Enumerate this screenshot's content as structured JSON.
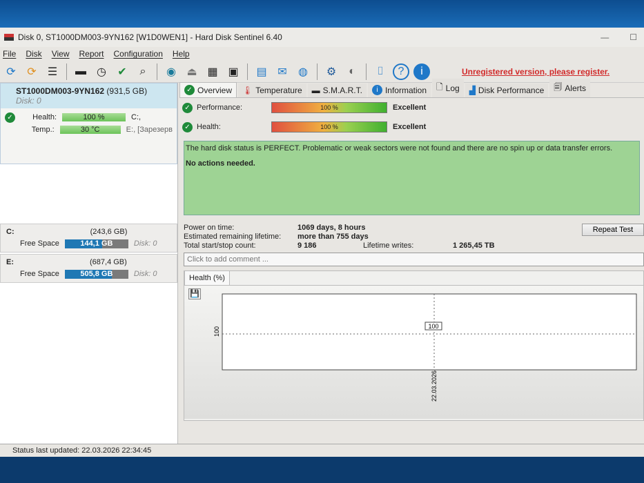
{
  "window": {
    "title": "Disk 0, ST1000DM003-9YN162 [W1D0WEN1]  -  Hard Disk Sentinel 6.40",
    "minimize": "—",
    "maximize": "☐"
  },
  "menu": [
    "File",
    "Disk",
    "View",
    "Report",
    "Configuration",
    "Help"
  ],
  "toolbar": {
    "unregistered": "Unregistered version, please register."
  },
  "disk": {
    "name": "ST1000DM003-9YN162",
    "size": "(931,5 GB)",
    "index": "Disk: 0",
    "health_label": "Health:",
    "health": "100 %",
    "temp_label": "Temp.:",
    "temp": "30 °C",
    "drive1": "C:,",
    "drive2": "E:, [Зарезерв"
  },
  "volumes": [
    {
      "letter": "C:",
      "size": "(243,6 GB)",
      "label": "Free Space",
      "free": "144,1 GB",
      "free_pct": 59,
      "disk": "Disk: 0"
    },
    {
      "letter": "E:",
      "size": "(687,4 GB)",
      "label": "Free Space",
      "free": "505,8 GB",
      "free_pct": 74,
      "disk": "Disk: 0"
    }
  ],
  "tabs": [
    "Overview",
    "Temperature",
    "S.M.A.R.T.",
    "Information",
    "Log",
    "Disk Performance",
    "Alerts"
  ],
  "overview": {
    "performance_label": "Performance:",
    "performance": "100 %",
    "performance_value": 100,
    "performance_rating": "Excellent",
    "health_label": "Health:",
    "health": "100 %",
    "health_value": 100,
    "health_rating": "Excellent",
    "status_text": "The hard disk status is PERFECT. Problematic or weak sectors were not found and there are no spin up or data transfer errors.",
    "actions": "No actions needed.",
    "power_on_label": "Power on time:",
    "power_on": "1069 days, 8 hours",
    "lifetime_label": "Estimated remaining lifetime:",
    "lifetime": "more than 755 days",
    "startstop_label": "Total start/stop count:",
    "startstop": "9 186",
    "writes_label": "Lifetime writes:",
    "writes": "1 265,45 TB",
    "repeat_test": "Repeat Test",
    "comment_placeholder": "Click to add comment ..."
  },
  "chart": {
    "tab": "Health (%)",
    "y_label": "100",
    "point_label": "100",
    "x_label": "22.03.2026"
  },
  "statusbar": "Status last updated: 22.03.2026 22:34:45"
}
